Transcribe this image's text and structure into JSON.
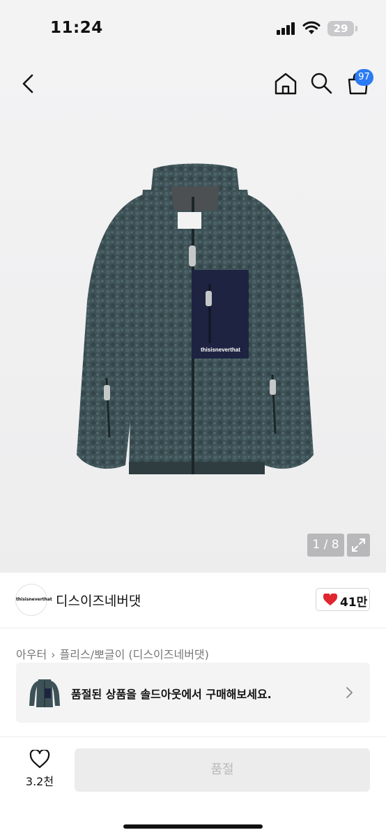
{
  "status_bar": {
    "time": "11:24",
    "battery": "29"
  },
  "nav": {
    "cart_badge": "97"
  },
  "gallery": {
    "page_indicator": "1 / 8"
  },
  "product_print": "thisisneverthat",
  "brand": {
    "logo_text": "thisisneverthat",
    "name": "디스이즈네버댓",
    "like_count": "41만"
  },
  "breadcrumb": [
    "아우터",
    "플리스/뽀글이 (디스이즈네버댓)"
  ],
  "soldout_banner": {
    "text": "품절된 상품을 솔드아웃에서 구매해보세요."
  },
  "bottom_bar": {
    "wish_count": "3.2천",
    "buy_label": "품절"
  },
  "colors": {
    "accent_blue": "#2b7bf3",
    "heart_red": "#e0262f",
    "jacket_green": "#3d5257",
    "pocket_navy": "#1d2340"
  }
}
